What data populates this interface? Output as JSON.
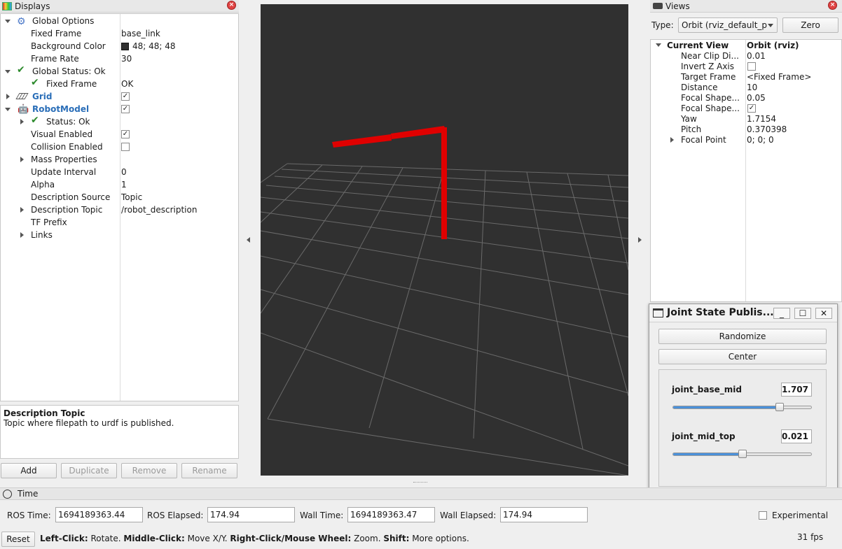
{
  "displays": {
    "title": "Displays",
    "tree": [
      {
        "label": "Global Options",
        "value": ""
      },
      {
        "label": "Fixed Frame",
        "value": "base_link"
      },
      {
        "label": "Background Color",
        "value": "48; 48; 48"
      },
      {
        "label": "Frame Rate",
        "value": "30"
      },
      {
        "label": "Global Status: Ok",
        "value": ""
      },
      {
        "label": "Fixed Frame",
        "value": "OK"
      },
      {
        "label": "Grid",
        "value": ""
      },
      {
        "label": "RobotModel",
        "value": ""
      },
      {
        "label": "Status: Ok",
        "value": ""
      },
      {
        "label": "Visual Enabled",
        "value": ""
      },
      {
        "label": "Collision Enabled",
        "value": ""
      },
      {
        "label": "Mass Properties",
        "value": ""
      },
      {
        "label": "Update Interval",
        "value": "0"
      },
      {
        "label": "Alpha",
        "value": "1"
      },
      {
        "label": "Description Source",
        "value": "Topic"
      },
      {
        "label": "Description Topic",
        "value": "/robot_description"
      },
      {
        "label": "TF Prefix",
        "value": ""
      },
      {
        "label": "Links",
        "value": ""
      }
    ],
    "description_title": "Description Topic",
    "description_text": "Topic where filepath to urdf is published.",
    "buttons": {
      "add": "Add",
      "duplicate": "Duplicate",
      "remove": "Remove",
      "rename": "Rename"
    }
  },
  "views": {
    "title": "Views",
    "type_label": "Type:",
    "type_value": "Orbit (rviz_default_p",
    "zero_label": "Zero",
    "current_view_label": "Current View",
    "current_view_value": "Orbit (rviz)",
    "props": [
      {
        "label": "Near Clip Di...",
        "value": "0.01"
      },
      {
        "label": "Invert Z Axis",
        "value": ""
      },
      {
        "label": "Target Frame",
        "value": "<Fixed Frame>"
      },
      {
        "label": "Distance",
        "value": "10"
      },
      {
        "label": "Focal Shape...",
        "value": "0.05"
      },
      {
        "label": "Focal Shape...",
        "value": ""
      },
      {
        "label": "Yaw",
        "value": "1.7154"
      },
      {
        "label": "Pitch",
        "value": "0.370398"
      },
      {
        "label": "Focal Point",
        "value": "0; 0; 0"
      }
    ]
  },
  "joint_state": {
    "title": "Joint State Publis...",
    "randomize_label": "Randomize",
    "center_label": "Center",
    "joints": [
      {
        "name": "joint_base_mid",
        "value": "1.707",
        "fraction": 0.77
      },
      {
        "name": "joint_mid_top",
        "value": "0.021",
        "fraction": 0.5
      }
    ]
  },
  "time": {
    "title": "Time",
    "ros_time_label": "ROS Time:",
    "ros_time_value": "1694189363.44",
    "ros_elapsed_label": "ROS Elapsed:",
    "ros_elapsed_value": "174.94",
    "wall_time_label": "Wall Time:",
    "wall_time_value": "1694189363.47",
    "wall_elapsed_label": "Wall Elapsed:",
    "wall_elapsed_value": "174.94",
    "experimental_label": "Experimental"
  },
  "statusbar": {
    "reset_label": "Reset",
    "hint_left_click": "Left-Click:",
    "hint_rotate": " Rotate. ",
    "hint_middle_click": "Middle-Click:",
    "hint_move": " Move X/Y. ",
    "hint_right_click": "Right-Click/Mouse Wheel:",
    "hint_zoom": " Zoom. ",
    "hint_shift": "Shift:",
    "hint_more": " More options.",
    "fps": "31 fps"
  },
  "colors": {
    "viewport_bg": "#303030",
    "robot": "#e00000",
    "grid": "#6a6a6a",
    "accent": "#2a6eb8"
  }
}
